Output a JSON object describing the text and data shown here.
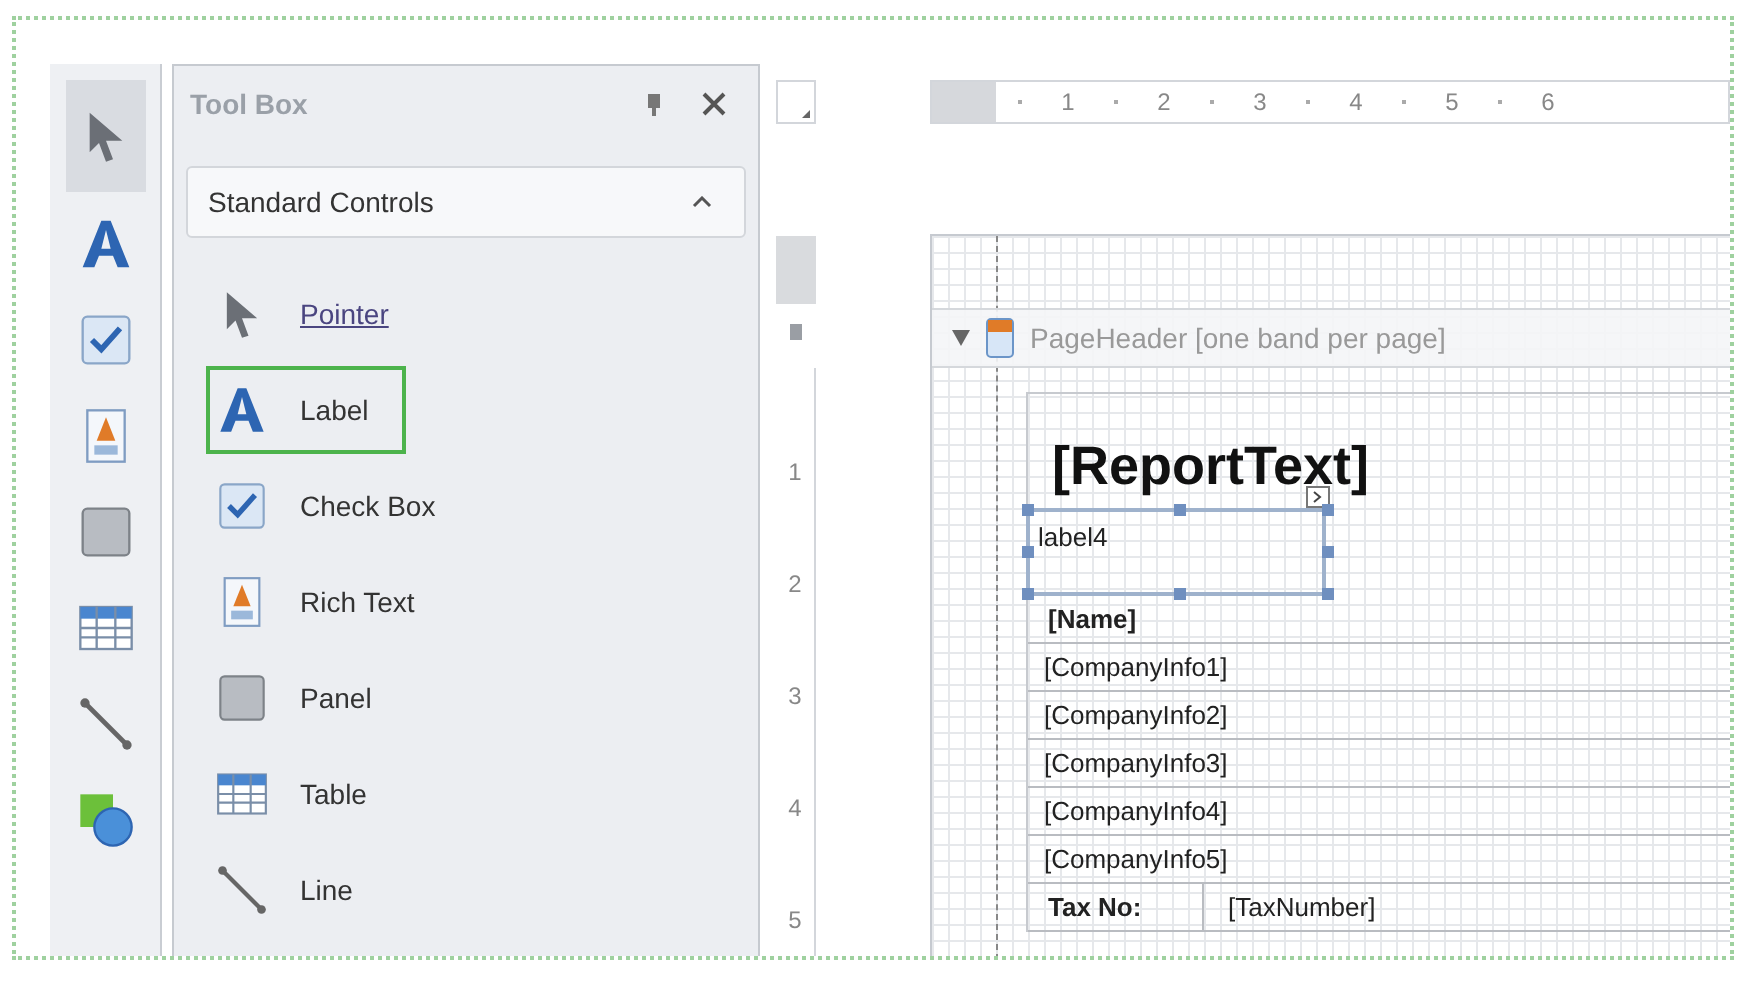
{
  "strip": [
    {
      "kind": "pointer",
      "selected": true
    },
    {
      "kind": "label",
      "selected": false
    },
    {
      "kind": "checkbox",
      "selected": false
    },
    {
      "kind": "richtext",
      "selected": false
    },
    {
      "kind": "panel",
      "selected": false
    },
    {
      "kind": "table",
      "selected": false
    },
    {
      "kind": "line",
      "selected": false
    },
    {
      "kind": "shape",
      "selected": false
    }
  ],
  "toolbox": {
    "title": "Tool Box",
    "group": {
      "label": "Standard Controls",
      "expanded": true
    },
    "items": [
      {
        "kind": "pointer",
        "label": "Pointer",
        "selected": false
      },
      {
        "kind": "label",
        "label": "Label",
        "selected": true
      },
      {
        "kind": "checkbox",
        "label": "Check Box",
        "selected": false
      },
      {
        "kind": "richtext",
        "label": "Rich Text",
        "selected": false
      },
      {
        "kind": "panel",
        "label": "Panel",
        "selected": false
      },
      {
        "kind": "table",
        "label": "Table",
        "selected": false
      },
      {
        "kind": "line",
        "label": "Line",
        "selected": false
      }
    ]
  },
  "top_ruler": [
    "1",
    "2",
    "3",
    "4",
    "5",
    "6"
  ],
  "left_ruler": [
    "1",
    "2",
    "3",
    "4",
    "5"
  ],
  "band": {
    "title": "PageHeader [one band per page]",
    "expanded": true
  },
  "report": {
    "title": "[ReportText]",
    "selected_label": "label4",
    "rows": [
      {
        "kind": "bold",
        "text": "[Name]"
      },
      {
        "kind": "plain",
        "text": "[CompanyInfo1]"
      },
      {
        "kind": "plain",
        "text": "[CompanyInfo2]"
      },
      {
        "kind": "plain",
        "text": "[CompanyInfo3]"
      },
      {
        "kind": "plain",
        "text": "[CompanyInfo4]"
      },
      {
        "kind": "plain",
        "text": "[CompanyInfo5]"
      },
      {
        "kind": "pair",
        "label": "Tax No:",
        "text": "[TaxNumber]"
      }
    ]
  }
}
